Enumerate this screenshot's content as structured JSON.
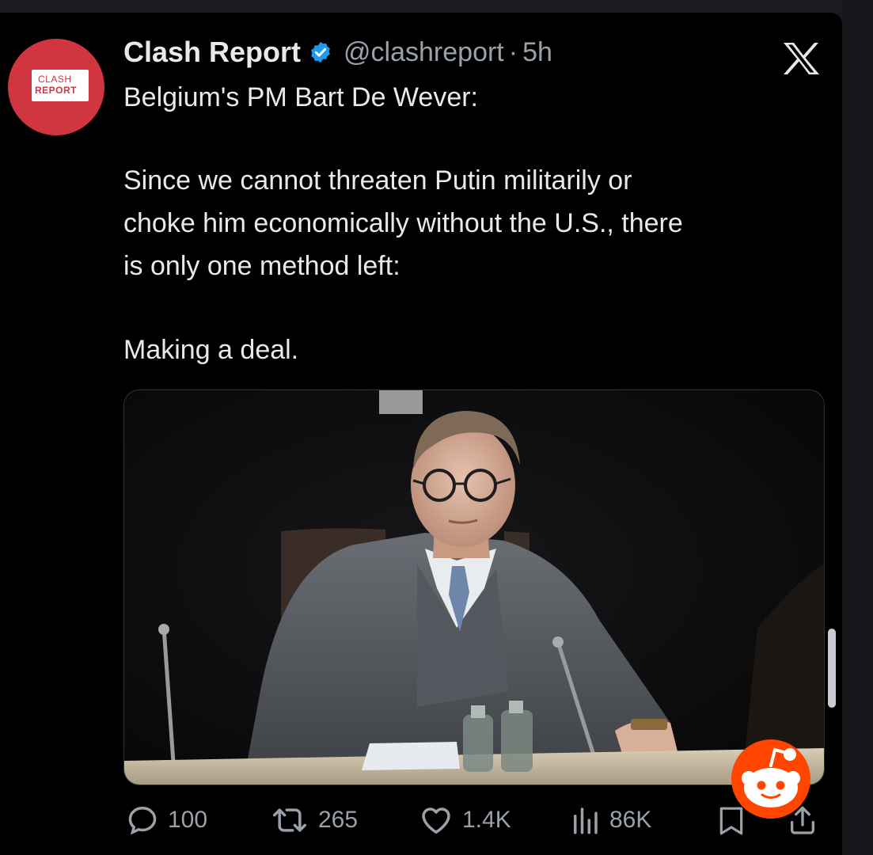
{
  "author": {
    "name": "Clash Report",
    "handle": "@clashreport",
    "separator": "·",
    "time": "5h",
    "verified": true,
    "avatar_text_top": "CLASH",
    "avatar_text_bottom": "REPORT"
  },
  "post": {
    "lines": [
      "Belgium's PM Bart De Wever:",
      "Since we cannot threaten Putin militarily or",
      "choke him economically without the U.S., there",
      "is only one method left:",
      "Making a deal."
    ],
    "image_description_icon": "photo-of-man-in-grey-suit-at-conference-table"
  },
  "actions": {
    "replies": "100",
    "reposts": "265",
    "likes": "1.4K",
    "views": "86K"
  },
  "colors": {
    "background": "#000000",
    "text": "#e7e9ea",
    "muted": "#9aa1a8",
    "verified": "#1d9bf0",
    "avatar": "#d1353f",
    "reddit": "#ff4500"
  },
  "icons": [
    "verified-icon",
    "x-logo-icon",
    "reply-icon",
    "repost-icon",
    "like-icon",
    "views-icon",
    "bookmark-icon",
    "share-icon",
    "reddit-icon"
  ]
}
